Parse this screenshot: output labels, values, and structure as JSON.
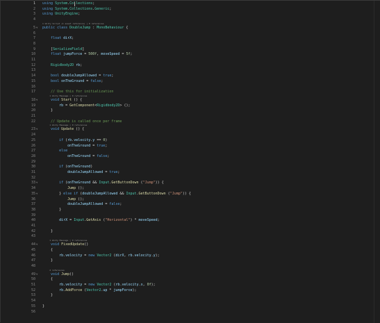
{
  "editor": {
    "language": "csharp",
    "active_line": 1,
    "colors": {
      "background": "#1e1e1e",
      "keyword": "#569cd6",
      "type": "#4ec9b0",
      "function": "#dcdcaa",
      "variable": "#9cdcfe",
      "string": "#ce9178",
      "number": "#b5cea8",
      "comment": "#6a9955",
      "line_number": "#858585"
    },
    "lines": [
      {
        "n": "1",
        "tokens": [
          [
            "kw",
            "using "
          ],
          [
            "ty",
            "System"
          ],
          [
            "pl",
            "."
          ],
          [
            "ty",
            "Collections"
          ],
          [
            "pl",
            ";"
          ]
        ]
      },
      {
        "n": "2",
        "tokens": [
          [
            "kw",
            "using "
          ],
          [
            "ty",
            "System"
          ],
          [
            "pl",
            "."
          ],
          [
            "ty",
            "Collections"
          ],
          [
            "pl",
            "."
          ],
          [
            "ty",
            "Generic"
          ],
          [
            "pl",
            ";"
          ]
        ]
      },
      {
        "n": "3",
        "tokens": [
          [
            "kw",
            "using "
          ],
          [
            "ty",
            "UnityEngine"
          ],
          [
            "pl",
            ";"
          ]
        ]
      },
      {
        "n": "4",
        "tokens": []
      },
      {
        "n": "5",
        "lens": "1 Unity Script (1 asset reference) | 0 references",
        "tokens": [
          [
            "kw",
            "public "
          ],
          [
            "kw",
            "class "
          ],
          [
            "ty",
            "DoubleJump"
          ],
          [
            "pl",
            " : "
          ],
          [
            "ty",
            "MonoBehaviour"
          ],
          [
            "pl",
            " {"
          ]
        ]
      },
      {
        "n": "6",
        "tokens": []
      },
      {
        "n": "7",
        "tokens": [
          [
            "pl",
            "    "
          ],
          [
            "kw",
            "float "
          ],
          [
            "vr",
            "dirX"
          ],
          [
            "pl",
            ";"
          ]
        ]
      },
      {
        "n": "8",
        "tokens": []
      },
      {
        "n": "9",
        "tokens": [
          [
            "pl",
            "    ["
          ],
          [
            "at",
            "SerializeField"
          ],
          [
            "pl",
            "]"
          ]
        ]
      },
      {
        "n": "10",
        "tokens": [
          [
            "pl",
            "    "
          ],
          [
            "kw",
            "float "
          ],
          [
            "vr",
            "jumpForce"
          ],
          [
            "pl",
            " = "
          ],
          [
            "nm",
            "500f"
          ],
          [
            "pl",
            ", "
          ],
          [
            "vr",
            "moveSpeed"
          ],
          [
            "pl",
            " = "
          ],
          [
            "nm",
            "5f"
          ],
          [
            "pl",
            ";"
          ]
        ]
      },
      {
        "n": "11",
        "tokens": []
      },
      {
        "n": "12",
        "tokens": [
          [
            "pl",
            "    "
          ],
          [
            "ty",
            "Rigidbody2D "
          ],
          [
            "vr",
            "rb"
          ],
          [
            "pl",
            ";"
          ]
        ]
      },
      {
        "n": "13",
        "tokens": []
      },
      {
        "n": "14",
        "tokens": [
          [
            "pl",
            "    "
          ],
          [
            "kw",
            "bool "
          ],
          [
            "vr",
            "doubleJumpAllowed"
          ],
          [
            "pl",
            " = "
          ],
          [
            "kw",
            "true"
          ],
          [
            "pl",
            ";"
          ]
        ]
      },
      {
        "n": "15",
        "tokens": [
          [
            "pl",
            "    "
          ],
          [
            "kw",
            "bool "
          ],
          [
            "vr",
            "onTheGround"
          ],
          [
            "pl",
            " = "
          ],
          [
            "kw",
            "false"
          ],
          [
            "pl",
            ";"
          ]
        ]
      },
      {
        "n": "16",
        "tokens": []
      },
      {
        "n": "17",
        "tokens": [
          [
            "pl",
            "    "
          ],
          [
            "cm",
            "// Use this for initialization"
          ]
        ]
      },
      {
        "n": "18",
        "lens": "1 Unity Message | 0 references",
        "tokens": [
          [
            "pl",
            "    "
          ],
          [
            "kw",
            "void "
          ],
          [
            "fn",
            "Start"
          ],
          [
            "pl",
            " () {"
          ]
        ]
      },
      {
        "n": "19",
        "tokens": [
          [
            "pl",
            "        "
          ],
          [
            "vr",
            "rb"
          ],
          [
            "pl",
            " = "
          ],
          [
            "fn",
            "GetComponent"
          ],
          [
            "pl",
            "<"
          ],
          [
            "ty",
            "Rigidbody2D"
          ],
          [
            "pl",
            "> ();"
          ]
        ]
      },
      {
        "n": "20",
        "tokens": [
          [
            "pl",
            "    }"
          ]
        ]
      },
      {
        "n": "21",
        "tokens": []
      },
      {
        "n": "22",
        "tokens": [
          [
            "pl",
            "    "
          ],
          [
            "cm",
            "// Update is called once per frame"
          ]
        ]
      },
      {
        "n": "23",
        "lens": "1 Unity Message | 0 references",
        "tokens": [
          [
            "pl",
            "    "
          ],
          [
            "kw",
            "void "
          ],
          [
            "fn",
            "Update"
          ],
          [
            "pl",
            " () {"
          ]
        ]
      },
      {
        "n": "24",
        "tokens": []
      },
      {
        "n": "25",
        "tokens": [
          [
            "pl",
            "        "
          ],
          [
            "kw",
            "if "
          ],
          [
            "pl",
            "("
          ],
          [
            "vr",
            "rb"
          ],
          [
            "pl",
            "."
          ],
          [
            "vr",
            "velocity"
          ],
          [
            "pl",
            "."
          ],
          [
            "vr",
            "y"
          ],
          [
            "pl",
            " == "
          ],
          [
            "nm",
            "0"
          ],
          [
            "pl",
            ")"
          ]
        ]
      },
      {
        "n": "26",
        "tokens": [
          [
            "pl",
            "            "
          ],
          [
            "vr",
            "onTheGround"
          ],
          [
            "pl",
            " = "
          ],
          [
            "kw",
            "true"
          ],
          [
            "pl",
            ";"
          ]
        ]
      },
      {
        "n": "27",
        "tokens": [
          [
            "pl",
            "        "
          ],
          [
            "kw",
            "else"
          ]
        ]
      },
      {
        "n": "28",
        "tokens": [
          [
            "pl",
            "            "
          ],
          [
            "vr",
            "onTheGround"
          ],
          [
            "pl",
            " = "
          ],
          [
            "kw",
            "false"
          ],
          [
            "pl",
            ";"
          ]
        ]
      },
      {
        "n": "29",
        "tokens": []
      },
      {
        "n": "30",
        "tokens": [
          [
            "pl",
            "        "
          ],
          [
            "kw",
            "if "
          ],
          [
            "pl",
            "("
          ],
          [
            "vr",
            "onTheGround"
          ],
          [
            "pl",
            ")"
          ]
        ]
      },
      {
        "n": "31",
        "tokens": [
          [
            "pl",
            "            "
          ],
          [
            "vr",
            "doubleJumpAllowed"
          ],
          [
            "pl",
            " = "
          ],
          [
            "kw",
            "true"
          ],
          [
            "pl",
            ";"
          ]
        ]
      },
      {
        "n": "32",
        "tokens": []
      },
      {
        "n": "33",
        "tokens": [
          [
            "pl",
            "        "
          ],
          [
            "kw",
            "if "
          ],
          [
            "pl",
            "("
          ],
          [
            "vr",
            "onTheGround"
          ],
          [
            "pl",
            " && "
          ],
          [
            "ty",
            "Input"
          ],
          [
            "pl",
            "."
          ],
          [
            "fn",
            "GetButtonDown"
          ],
          [
            "pl",
            " ("
          ],
          [
            "st",
            "\"Jump\""
          ],
          [
            "pl",
            ")) {"
          ]
        ]
      },
      {
        "n": "34",
        "tokens": [
          [
            "pl",
            "            "
          ],
          [
            "fn",
            "Jump"
          ],
          [
            "pl",
            " ();"
          ]
        ]
      },
      {
        "n": "35",
        "tokens": [
          [
            "pl",
            "        } "
          ],
          [
            "kw",
            "else if "
          ],
          [
            "pl",
            "("
          ],
          [
            "vr",
            "doubleJumpAllowed"
          ],
          [
            "pl",
            " && "
          ],
          [
            "ty",
            "Input"
          ],
          [
            "pl",
            "."
          ],
          [
            "fn",
            "GetButtonDown"
          ],
          [
            "pl",
            " ("
          ],
          [
            "st",
            "\"Jump\""
          ],
          [
            "pl",
            ")) {"
          ]
        ]
      },
      {
        "n": "36",
        "tokens": [
          [
            "pl",
            "            "
          ],
          [
            "fn",
            "Jump"
          ],
          [
            "pl",
            " ();"
          ]
        ]
      },
      {
        "n": "37",
        "tokens": [
          [
            "pl",
            "            "
          ],
          [
            "vr",
            "doubleJumpAllowed"
          ],
          [
            "pl",
            " = "
          ],
          [
            "kw",
            "false"
          ],
          [
            "pl",
            ";"
          ]
        ]
      },
      {
        "n": "38",
        "tokens": [
          [
            "pl",
            "        }"
          ]
        ]
      },
      {
        "n": "39",
        "tokens": []
      },
      {
        "n": "40",
        "tokens": [
          [
            "pl",
            "        "
          ],
          [
            "vr",
            "dirX"
          ],
          [
            "pl",
            " = "
          ],
          [
            "ty",
            "Input"
          ],
          [
            "pl",
            "."
          ],
          [
            "fn",
            "GetAxis"
          ],
          [
            "pl",
            " ("
          ],
          [
            "st",
            "\"Horizontal\""
          ],
          [
            "pl",
            ") * "
          ],
          [
            "vr",
            "moveSpeed"
          ],
          [
            "pl",
            ";"
          ]
        ]
      },
      {
        "n": "41",
        "tokens": []
      },
      {
        "n": "42",
        "tokens": [
          [
            "pl",
            "    }"
          ]
        ]
      },
      {
        "n": "43",
        "tokens": []
      },
      {
        "n": "44",
        "lens": "1 Unity Message | 0 references",
        "tokens": [
          [
            "pl",
            "    "
          ],
          [
            "kw",
            "void "
          ],
          [
            "fn",
            "FixedUpdate"
          ],
          [
            "pl",
            "()"
          ]
        ]
      },
      {
        "n": "45",
        "tokens": [
          [
            "pl",
            "    {"
          ]
        ]
      },
      {
        "n": "46",
        "tokens": [
          [
            "pl",
            "        "
          ],
          [
            "vr",
            "rb"
          ],
          [
            "pl",
            "."
          ],
          [
            "vr",
            "velocity"
          ],
          [
            "pl",
            " = "
          ],
          [
            "kw",
            "new "
          ],
          [
            "ty",
            "Vector2"
          ],
          [
            "pl",
            " ("
          ],
          [
            "vr",
            "dirX"
          ],
          [
            "pl",
            ", "
          ],
          [
            "vr",
            "rb"
          ],
          [
            "pl",
            "."
          ],
          [
            "vr",
            "velocity"
          ],
          [
            "pl",
            "."
          ],
          [
            "vr",
            "y"
          ],
          [
            "pl",
            ");"
          ]
        ]
      },
      {
        "n": "47",
        "tokens": [
          [
            "pl",
            "    }"
          ]
        ]
      },
      {
        "n": "48",
        "tokens": []
      },
      {
        "n": "49",
        "lens": "2 references",
        "tokens": [
          [
            "pl",
            "    "
          ],
          [
            "kw",
            "void "
          ],
          [
            "fn",
            "Jump"
          ],
          [
            "pl",
            "()"
          ]
        ]
      },
      {
        "n": "50",
        "tokens": [
          [
            "pl",
            "    {"
          ]
        ]
      },
      {
        "n": "51",
        "tokens": [
          [
            "pl",
            "        "
          ],
          [
            "vr",
            "rb"
          ],
          [
            "pl",
            "."
          ],
          [
            "vr",
            "velocity"
          ],
          [
            "pl",
            " = "
          ],
          [
            "kw",
            "new "
          ],
          [
            "ty",
            "Vector2"
          ],
          [
            "pl",
            " ("
          ],
          [
            "vr",
            "rb"
          ],
          [
            "pl",
            "."
          ],
          [
            "vr",
            "velocity"
          ],
          [
            "pl",
            "."
          ],
          [
            "vr",
            "x"
          ],
          [
            "pl",
            ", "
          ],
          [
            "nm",
            "0f"
          ],
          [
            "pl",
            ");"
          ]
        ]
      },
      {
        "n": "52",
        "tokens": [
          [
            "pl",
            "        "
          ],
          [
            "vr",
            "rb"
          ],
          [
            "pl",
            "."
          ],
          [
            "fn",
            "AddForce"
          ],
          [
            "pl",
            " ("
          ],
          [
            "ty",
            "Vector2"
          ],
          [
            "pl",
            "."
          ],
          [
            "vr",
            "up"
          ],
          [
            "pl",
            " * "
          ],
          [
            "vr",
            "jumpForce"
          ],
          [
            "pl",
            ");"
          ]
        ]
      },
      {
        "n": "53",
        "tokens": [
          [
            "pl",
            "    }"
          ]
        ]
      },
      {
        "n": "54",
        "tokens": []
      },
      {
        "n": "55",
        "tokens": [
          [
            "pl",
            "}"
          ]
        ]
      },
      {
        "n": "56",
        "tokens": []
      }
    ]
  }
}
